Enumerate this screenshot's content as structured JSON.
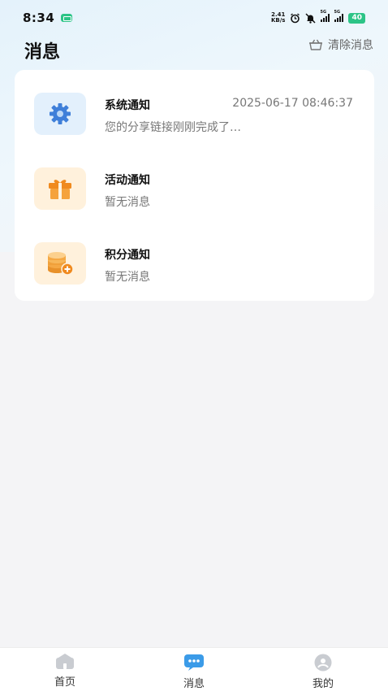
{
  "status_bar": {
    "time": "8:34",
    "net_speed_value": "2.41",
    "net_speed_unit": "KB/s",
    "signal_tag_1": "5G",
    "signal_tag_2": "5G",
    "battery": "40",
    "colors": {
      "battery": "#2cc487"
    }
  },
  "header": {
    "title": "消息",
    "clear_label": "清除消息"
  },
  "messages": [
    {
      "title": "系统通知",
      "time": "2025-06-17 08:46:37",
      "preview": "您的分享链接刚刚完成了…",
      "icon": "gear-icon"
    },
    {
      "title": "活动通知",
      "time": "",
      "preview": "暂无消息",
      "icon": "gift-icon"
    },
    {
      "title": "积分通知",
      "time": "",
      "preview": "暂无消息",
      "icon": "coins-icon"
    }
  ],
  "tabbar": {
    "tabs": [
      {
        "label": "首页",
        "icon": "home-icon",
        "active": false
      },
      {
        "label": "消息",
        "icon": "chat-icon",
        "active": true
      },
      {
        "label": "我的",
        "icon": "profile-icon",
        "active": false
      }
    ],
    "colors": {
      "active": "#3b9be8",
      "inactive": "#c9ccd1"
    }
  }
}
